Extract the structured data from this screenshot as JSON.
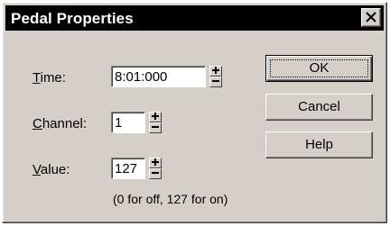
{
  "dialog": {
    "title": "Pedal Properties",
    "close_icon": "close-x-icon"
  },
  "fields": {
    "time": {
      "label_first": "T",
      "label_rest": "ime:",
      "value": "8:01:000"
    },
    "channel": {
      "label_first": "C",
      "label_rest": "hannel:",
      "value": "1"
    },
    "value": {
      "label_first": "V",
      "label_rest": "alue:",
      "value": "127"
    }
  },
  "buttons": {
    "ok": "OK",
    "cancel": "Cancel",
    "help": "Help"
  },
  "hint": "(0 for off, 127 for on)",
  "colors": {
    "face": "#d4d0c8",
    "titlebar": "#000000"
  }
}
